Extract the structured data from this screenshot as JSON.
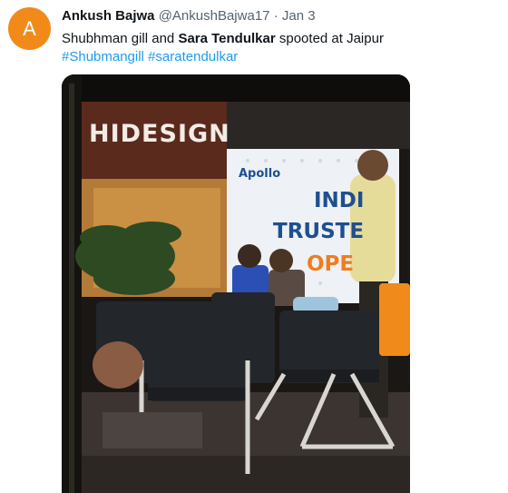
{
  "tweet": {
    "avatar_letter": "A",
    "avatar_color": "#f28a1a",
    "display_name": "Ankush Bajwa",
    "handle": "@AnkushBajwa17",
    "separator": "·",
    "date": "Jan 3",
    "text_part1": "Shubhman gill and ",
    "text_bold": "Sara Tendulkar",
    "text_part2": " spooted at Jaipur",
    "hashtag1": "#Shubmangill",
    "hashtag2": "#saratendulkar",
    "link_color": "#1d9bf0"
  },
  "photo": {
    "store_sign": "HIDESIGN",
    "apollo_logo": "Apollo",
    "banner_line1": "INDI",
    "banner_line2": "TRUSTE",
    "banner_line3": "OPE"
  }
}
